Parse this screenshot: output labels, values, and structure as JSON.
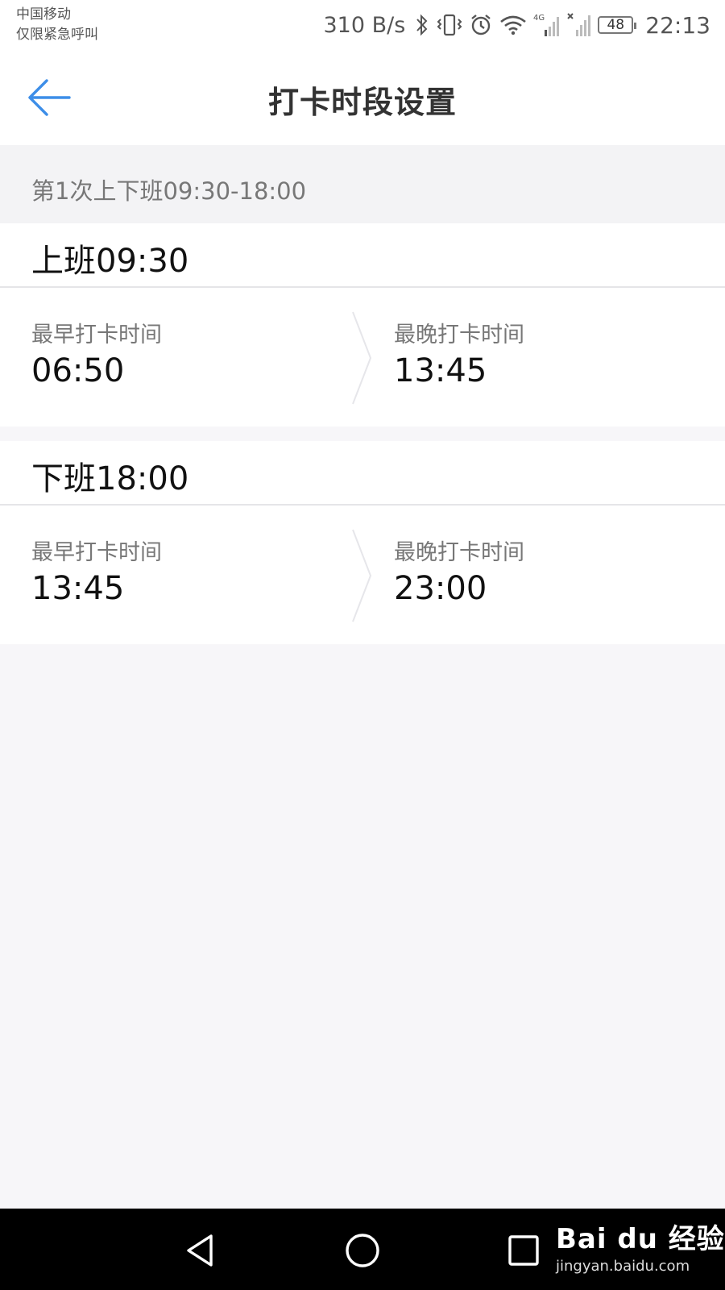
{
  "status_bar": {
    "carrier_line1": "中国移动",
    "carrier_line2": "仅限紧急呼叫",
    "net_speed": "310 B/s",
    "network_type": "4G",
    "battery": "48",
    "time": "22:13",
    "icons": [
      "bluetooth-icon",
      "vibrate-icon",
      "alarm-icon",
      "wifi-icon",
      "signal-icon",
      "no-signal-icon",
      "battery-icon"
    ]
  },
  "header": {
    "title": "打卡时段设置",
    "back_icon": "arrow-left-icon",
    "accent_color": "#3d8ee8"
  },
  "section": {
    "title": "第1次上下班09:30-18:00"
  },
  "clock_in": {
    "title": "上班09:30",
    "earliest_label": "最早打卡时间",
    "earliest_value": "06:50",
    "latest_label": "最晚打卡时间",
    "latest_value": "13:45"
  },
  "clock_out": {
    "title": "下班18:00",
    "earliest_label": "最早打卡时间",
    "earliest_value": "13:45",
    "latest_label": "最晚打卡时间",
    "latest_value": "23:00"
  },
  "nav_bar": {
    "icons": [
      "back-triangle-icon",
      "home-circle-icon",
      "recents-square-icon"
    ]
  },
  "watermark": {
    "logo": "Bai du 经验",
    "url": "jingyan.baidu.com"
  }
}
